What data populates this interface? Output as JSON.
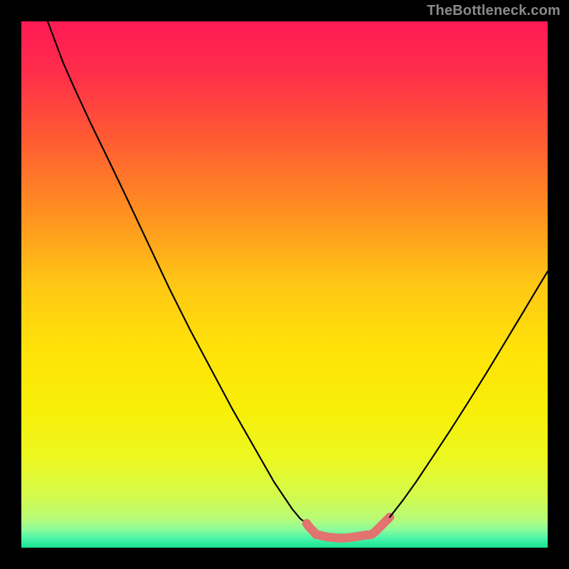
{
  "attribution": "TheBottleneck.com",
  "chart_data": {
    "type": "line",
    "title": "",
    "xlabel": "",
    "ylabel": "",
    "xlim": [
      0,
      100
    ],
    "ylim": [
      0,
      100
    ],
    "gradient": [
      {
        "offset": 0.0,
        "color": "#ff1a55"
      },
      {
        "offset": 0.1,
        "color": "#ff2e4a"
      },
      {
        "offset": 0.22,
        "color": "#ff5a33"
      },
      {
        "offset": 0.35,
        "color": "#ff8b22"
      },
      {
        "offset": 0.5,
        "color": "#ffc715"
      },
      {
        "offset": 0.62,
        "color": "#ffe208"
      },
      {
        "offset": 0.74,
        "color": "#f7ef08"
      },
      {
        "offset": 0.83,
        "color": "#ecf720"
      },
      {
        "offset": 0.9,
        "color": "#d4fa4a"
      },
      {
        "offset": 0.945,
        "color": "#b8fb78"
      },
      {
        "offset": 0.965,
        "color": "#8efc9a"
      },
      {
        "offset": 0.985,
        "color": "#42f3a8"
      },
      {
        "offset": 1.0,
        "color": "#17e28f"
      }
    ],
    "series": [
      {
        "name": "curve-left",
        "style": "thin-black",
        "points": [
          [
            5.0,
            100.0
          ],
          [
            6.5,
            96.0
          ],
          [
            8.0,
            92.0
          ],
          [
            10.0,
            87.5
          ],
          [
            13.0,
            81.0
          ],
          [
            16.5,
            73.8
          ],
          [
            20.0,
            66.5
          ],
          [
            24.0,
            58.0
          ],
          [
            28.0,
            49.5
          ],
          [
            32.0,
            41.5
          ],
          [
            36.0,
            34.0
          ],
          [
            40.0,
            26.5
          ],
          [
            44.0,
            19.5
          ],
          [
            48.0,
            12.5
          ],
          [
            51.5,
            7.3
          ],
          [
            53.0,
            5.5
          ],
          [
            54.2,
            4.6
          ]
        ]
      },
      {
        "name": "highlight-band",
        "style": "thick-red",
        "points": [
          [
            54.2,
            4.6
          ],
          [
            54.8,
            3.8
          ],
          [
            55.4,
            3.2
          ],
          [
            56.0,
            2.5
          ],
          [
            56.5,
            2.4
          ],
          [
            57.3,
            2.2
          ],
          [
            58.3,
            2.0
          ],
          [
            59.3,
            1.9
          ],
          [
            60.5,
            1.8
          ],
          [
            61.7,
            1.85
          ],
          [
            63.0,
            2.0
          ],
          [
            64.3,
            2.2
          ],
          [
            65.5,
            2.4
          ],
          [
            66.5,
            2.5
          ],
          [
            67.2,
            3.0
          ],
          [
            67.8,
            3.6
          ],
          [
            68.5,
            4.3
          ],
          [
            69.2,
            5.0
          ],
          [
            70.0,
            5.8
          ]
        ]
      },
      {
        "name": "curve-right",
        "style": "thin-black",
        "points": [
          [
            70.0,
            5.8
          ],
          [
            72.5,
            9.0
          ],
          [
            75.0,
            12.5
          ],
          [
            78.0,
            17.0
          ],
          [
            81.5,
            22.3
          ],
          [
            85.0,
            27.8
          ],
          [
            88.5,
            33.4
          ],
          [
            92.0,
            39.2
          ],
          [
            95.5,
            45.0
          ],
          [
            98.0,
            49.2
          ],
          [
            100.0,
            52.5
          ]
        ]
      }
    ],
    "styles": {
      "thin-black": {
        "stroke": "#000000",
        "width": 2.2,
        "linecap": "round",
        "linejoin": "round"
      },
      "thick-red": {
        "stroke": "#e2736e",
        "width": 12.5,
        "linecap": "round",
        "linejoin": "round"
      }
    }
  }
}
